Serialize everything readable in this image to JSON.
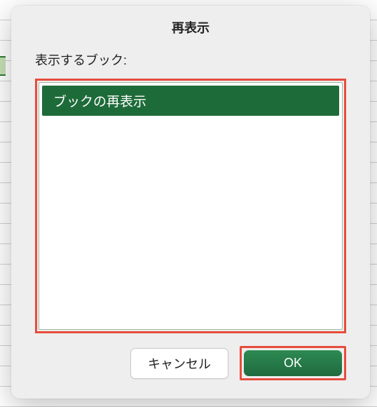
{
  "dialog": {
    "title": "再表示",
    "list_label": "表示するブック:",
    "items": [
      {
        "label": "ブックの再表示",
        "selected": true
      }
    ],
    "buttons": {
      "cancel": "キャンセル",
      "ok": "OK"
    }
  },
  "highlight_color": "#e74c3c",
  "selection_bg": "#1e6b3a"
}
